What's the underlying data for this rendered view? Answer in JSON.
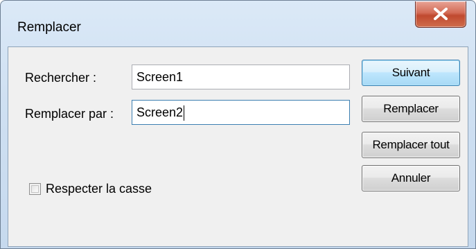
{
  "window": {
    "title": "Remplacer"
  },
  "form": {
    "find_label": "Rechercher :",
    "find_value": "Screen1",
    "replace_label": "Remplacer par :",
    "replace_value": "Screen2",
    "match_case_label": "Respecter la casse",
    "match_case_checked": false
  },
  "buttons": {
    "next": "Suivant",
    "replace": "Remplacer",
    "replace_all": "Remplacer tout",
    "cancel": "Annuler"
  },
  "icons": {
    "close": "close-icon"
  },
  "colors": {
    "close_button": "#c9593e",
    "default_button_border": "#3c7fb1",
    "dialog_background": "#f0f0f0"
  }
}
